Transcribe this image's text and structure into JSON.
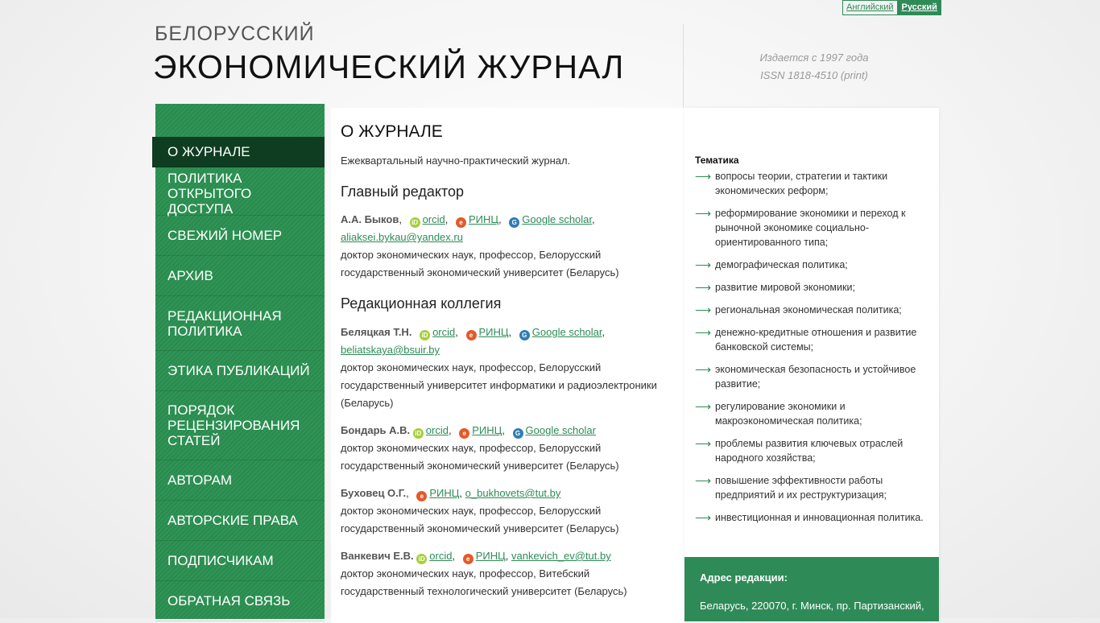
{
  "lang": {
    "en": "Английский",
    "ru": "Русский"
  },
  "header": {
    "logo_top": "БЕЛОРУССКИЙ",
    "logo_main": "ЭКОНОМИЧЕСКИЙ ЖУРНАЛ",
    "published": "Издается с 1997 года",
    "issn": "ISSN 1818-4510 (print)"
  },
  "nav": [
    "О ЖУРНАЛЕ",
    "ПОЛИТИКА ОТКРЫТОГО ДОСТУПА",
    "СВЕЖИЙ НОМЕР",
    "АРХИВ",
    "РЕДАКЦИОННАЯ ПОЛИТИКА",
    "ЭТИКА ПУБЛИКАЦИЙ",
    "ПОРЯДОК РЕЦЕНЗИРОВАНИЯ СТАТЕЙ",
    "АВТОРАМ",
    "АВТОРСКИЕ ПРАВА",
    "ПОДПИСЧИКАМ",
    "ОБРАТНАЯ СВЯЗЬ"
  ],
  "main": {
    "title": "О ЖУРНАЛЕ",
    "intro": "Ежеквартальный научно-практический журнал.",
    "editor_heading": "Главный редактор",
    "board_heading": "Редакционная коллегия",
    "links": {
      "orcid": "orcid",
      "rinc": "РИНЦ",
      "gs": "Google scholar"
    },
    "editor": {
      "name": "А.А. Быков",
      "email": "aliaksei.bykau@yandex.ru",
      "desc": "доктор экономических наук, профессор, Белорусский государственный экономический университет (Беларусь)"
    },
    "board": [
      {
        "name": "Беляцкая Т.Н.",
        "email": "beliatskaya@bsuir.by",
        "desc": "доктор экономических наук, профессор, Белорусский государственный университет информатики и радиоэлектроники (Беларусь)"
      },
      {
        "name": "Бондарь А.В.",
        "desc": "доктор экономических наук, профессор, Белорусский государственный экономический университет (Беларусь)"
      },
      {
        "name": "Буховец О.Г.",
        "email": "o_bukhovets@tut.by",
        "desc": "доктор экономических наук, профессор, Белорусский государственный экономический университет (Беларусь)"
      },
      {
        "name": "Ванкевич Е.В.",
        "email": "vankevich_ev@tut.by",
        "desc": "доктор экономических наук, профессор, Витебский государственный технологический университет (Беларусь)"
      }
    ]
  },
  "sidebar_right": {
    "topics_title": "Тематика",
    "topics": [
      "вопросы теории, стратегии и тактики экономических реформ;",
      "реформирование экономики и переход к рыночной экономике социально-ориентированного типа;",
      "демографическая политика;",
      "развитие мировой экономики;",
      "региональная экономическая политика;",
      "денежно-кредитные отношения и развитие банковской системы;",
      "экономическая безопасность и устойчивое развитие;",
      "регулирование экономики и макроэкономическая политика;",
      "проблемы развития ключевых отраслей народного хозяйства;",
      "повышение эффективности работы предприятий и их реструктуризация;",
      "инвестиционная и инновационная политика."
    ],
    "address_title": "Адрес редакции:",
    "address_value": "Беларусь, 220070, г. Минск, пр. Партизанский,"
  },
  "colors": {
    "brand": "#2e8b57",
    "nav_active": "#0f3d22"
  }
}
